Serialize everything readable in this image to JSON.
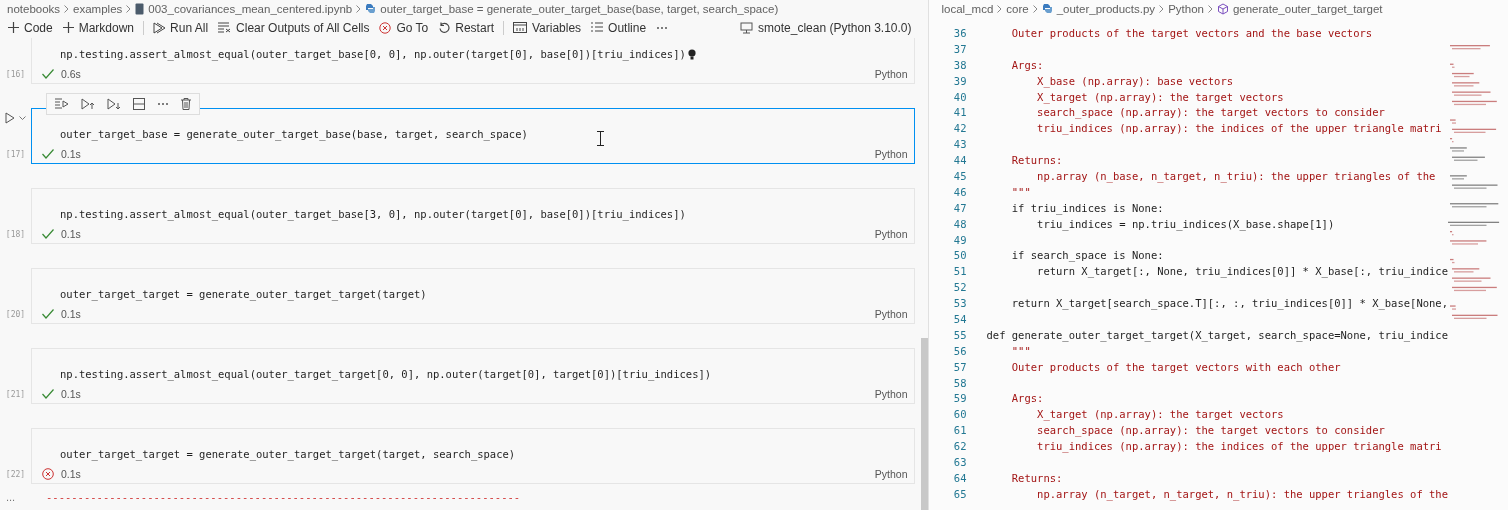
{
  "notebook": {
    "breadcrumbs": [
      {
        "label": "notebooks",
        "kind": "folder"
      },
      {
        "label": "examples",
        "kind": "folder"
      },
      {
        "label": "003_covariances_mean_centered.ipynb",
        "kind": "notebook"
      },
      {
        "label": "outer_target_base = generate_outer_target_base(base, target, search_space)",
        "kind": "python"
      }
    ],
    "toolbar": [
      [
        {
          "label": "Code",
          "kind": "add"
        },
        {
          "label": "Markdown",
          "kind": "add"
        }
      ],
      [
        {
          "label": "Run All",
          "kind": "run-all"
        },
        {
          "label": "Clear Outputs of All Cells",
          "kind": "clear"
        },
        {
          "label": "Go To",
          "kind": "goto"
        },
        {
          "label": "Restart",
          "kind": "restart"
        }
      ],
      [
        {
          "label": "Variables",
          "kind": "variables"
        },
        {
          "label": "Outline",
          "kind": "outline"
        },
        {
          "label": "⋯",
          "kind": "more"
        }
      ]
    ],
    "kernel": "smote_clean (Python 3.10.0)",
    "cells": [
      {
        "count": "[16]",
        "code": "np.testing.assert_almost_equal(outer_target_base[0, 0], np.outer(target[0], base[0])[triu_indices])",
        "failed": false,
        "time": "0.6s",
        "language": "Python",
        "selected": false,
        "lightbulb": true
      },
      {
        "count": "[17]",
        "code": "outer_target_base = generate_outer_target_base(base, target, search_space)",
        "failed": false,
        "time": "0.1s",
        "language": "Python",
        "selected": true,
        "lightbulb": false
      },
      {
        "count": "[18]",
        "code": "np.testing.assert_almost_equal(outer_target_base[3, 0], np.outer(target[0], base[0])[triu_indices])",
        "failed": false,
        "time": "0.1s",
        "language": "Python",
        "selected": false,
        "lightbulb": false
      },
      {
        "count": "[20]",
        "code": "outer_target_target = generate_outer_target_target(target)",
        "failed": false,
        "time": "0.1s",
        "language": "Python",
        "selected": false,
        "lightbulb": false
      },
      {
        "count": "[21]",
        "code": "np.testing.assert_almost_equal(outer_target_target[0, 0], np.outer(target[0], target[0])[triu_indices])",
        "failed": false,
        "time": "0.1s",
        "language": "Python",
        "selected": false,
        "lightbulb": false
      },
      {
        "count": "[22]",
        "code": "outer_target_target = generate_outer_target_target(target, search_space)",
        "failed": true,
        "time": "0.1s",
        "language": "Python",
        "selected": false,
        "lightbulb": false
      }
    ],
    "output_more": "...",
    "error_rule": "---------------------------------------------------------------------------"
  },
  "editor": {
    "breadcrumbs": [
      {
        "label": "local_mcd",
        "kind": "folder"
      },
      {
        "label": "core",
        "kind": "folder"
      },
      {
        "label": "_outer_products.py",
        "kind": "python"
      },
      {
        "label": "Python",
        "kind": "folder"
      },
      {
        "label": "generate_outer_target_target",
        "kind": "method"
      }
    ],
    "lines": [
      {
        "number": "36",
        "text": "    Outer products of the target vectors and the base vectors",
        "kind": "doc"
      },
      {
        "number": "37"
      },
      {
        "number": "38",
        "text": "    Args:",
        "kind": "doc"
      },
      {
        "number": "39",
        "text": "        X_base (np.array): base vectors",
        "kind": "doc"
      },
      {
        "number": "40",
        "text": "        X_target (np.array): the target vectors",
        "kind": "doc"
      },
      {
        "number": "41",
        "text": "        search_space (np.array): the target vectors to consider",
        "kind": "doc"
      },
      {
        "number": "42",
        "text": "        triu_indices (np.array): the indices of the upper triangle matri",
        "kind": "doc"
      },
      {
        "number": "43"
      },
      {
        "number": "44",
        "text": "    Returns:",
        "kind": "doc"
      },
      {
        "number": "45",
        "text": "        np.array (n_base, n_target, n_triu): the upper triangles of the",
        "kind": "doc"
      },
      {
        "number": "46",
        "text": "    \"\"\"",
        "kind": "doc"
      },
      {
        "number": "47",
        "text": "    if triu_indices is None:",
        "kind": "code"
      },
      {
        "number": "48",
        "text": "        triu_indices = np.triu_indices(X_base.shape[1])",
        "kind": "code"
      },
      {
        "number": "49"
      },
      {
        "number": "50",
        "text": "    if search_space is None:",
        "kind": "code"
      },
      {
        "number": "51",
        "text": "        return X_target[:, None, triu_indices[0]] * X_base[:, triu_indice",
        "kind": "code"
      },
      {
        "number": "52"
      },
      {
        "number": "53",
        "text": "    return X_target[search_space.T][:, :, triu_indices[0]] * X_base[None,",
        "kind": "code"
      },
      {
        "number": "54"
      },
      {
        "number": "55",
        "text": "def generate_outer_target_target(X_target, search_space=None, triu_indice",
        "kind": "code"
      },
      {
        "number": "56",
        "text": "    \"\"\"",
        "kind": "doc"
      },
      {
        "number": "57",
        "text": "    Outer products of the target vectors with each other",
        "kind": "doc"
      },
      {
        "number": "58"
      },
      {
        "number": "59",
        "text": "    Args:",
        "kind": "doc"
      },
      {
        "number": "60",
        "text": "        X_target (np.array): the target vectors",
        "kind": "doc"
      },
      {
        "number": "61",
        "text": "        search_space (np.array): the target vectors to consider",
        "kind": "doc"
      },
      {
        "number": "62",
        "text": "        triu_indices (np.array): the indices of the upper triangle matri",
        "kind": "doc"
      },
      {
        "number": "63"
      },
      {
        "number": "64",
        "text": "    Returns:",
        "kind": "doc"
      },
      {
        "number": "65",
        "text": "        np.array (n_target, n_target, n_triu): the upper triangles of the",
        "kind": "doc"
      }
    ]
  }
}
